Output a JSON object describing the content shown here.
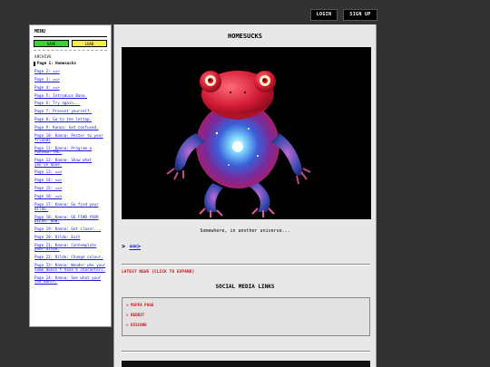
{
  "header": {
    "login": "LOGIN",
    "signup": "SIGN UP"
  },
  "sidebar": {
    "title": "MENU",
    "save": "SAVE",
    "load": "LOAD",
    "archive": "ARCHIVE",
    "pages": [
      "Page 1: Homesucks",
      "Page 2: ==>",
      "Page 3: ==>",
      "Page 4: ==>",
      "Page 5: Introduce Bane.",
      "Page 6: Try again...",
      "Page 7: Present yourself.",
      "Page 8: Go to the lettop.",
      "Page 9: Kanna: Get confused.",
      "Page 10: Kanna: Pester to your friends",
      "Page 11: Kanna: Program a Pokemon-TML.",
      "Page 12: Kanna: Show what you've done.",
      "Page 13: ==>",
      "Page 14: ==>",
      "Page 15: ==>",
      "Page 16: ==>",
      "Page 17: Kanna: Go find your dildo.",
      "Page 18: Kanna: GO FIND YOUR DILDO. NOW.",
      "Page 19: Kanna: Get closer...",
      "Page 20: Dildo: Exit",
      "Page 21: Kanna: Contemplate your dildo.",
      "Page 22: Dildo: Change colour.",
      "Page 23: Kanna: Wonder who your name doesn't have 6 characters.",
      "Page 24: Kanna: See what your the wants."
    ],
    "current_index": 0
  },
  "main": {
    "title": "HOMESUCKS",
    "caption": "Somewhere, in another universe...",
    "next_prefix": ">",
    "next_link": "==>",
    "news": "LATEST NEWS [CLICK TO EXPAND]",
    "social_title": "SOCIAL MEDIA LINKS",
    "social_links": [
      "> MSPFA PAGE",
      "> REDDIT",
      "> DISCORD"
    ]
  },
  "colors": {
    "background": "#323232",
    "link": "#1a1ad6",
    "news": "#d41414",
    "save": "#3ad13a",
    "load": "#f2f23a"
  }
}
